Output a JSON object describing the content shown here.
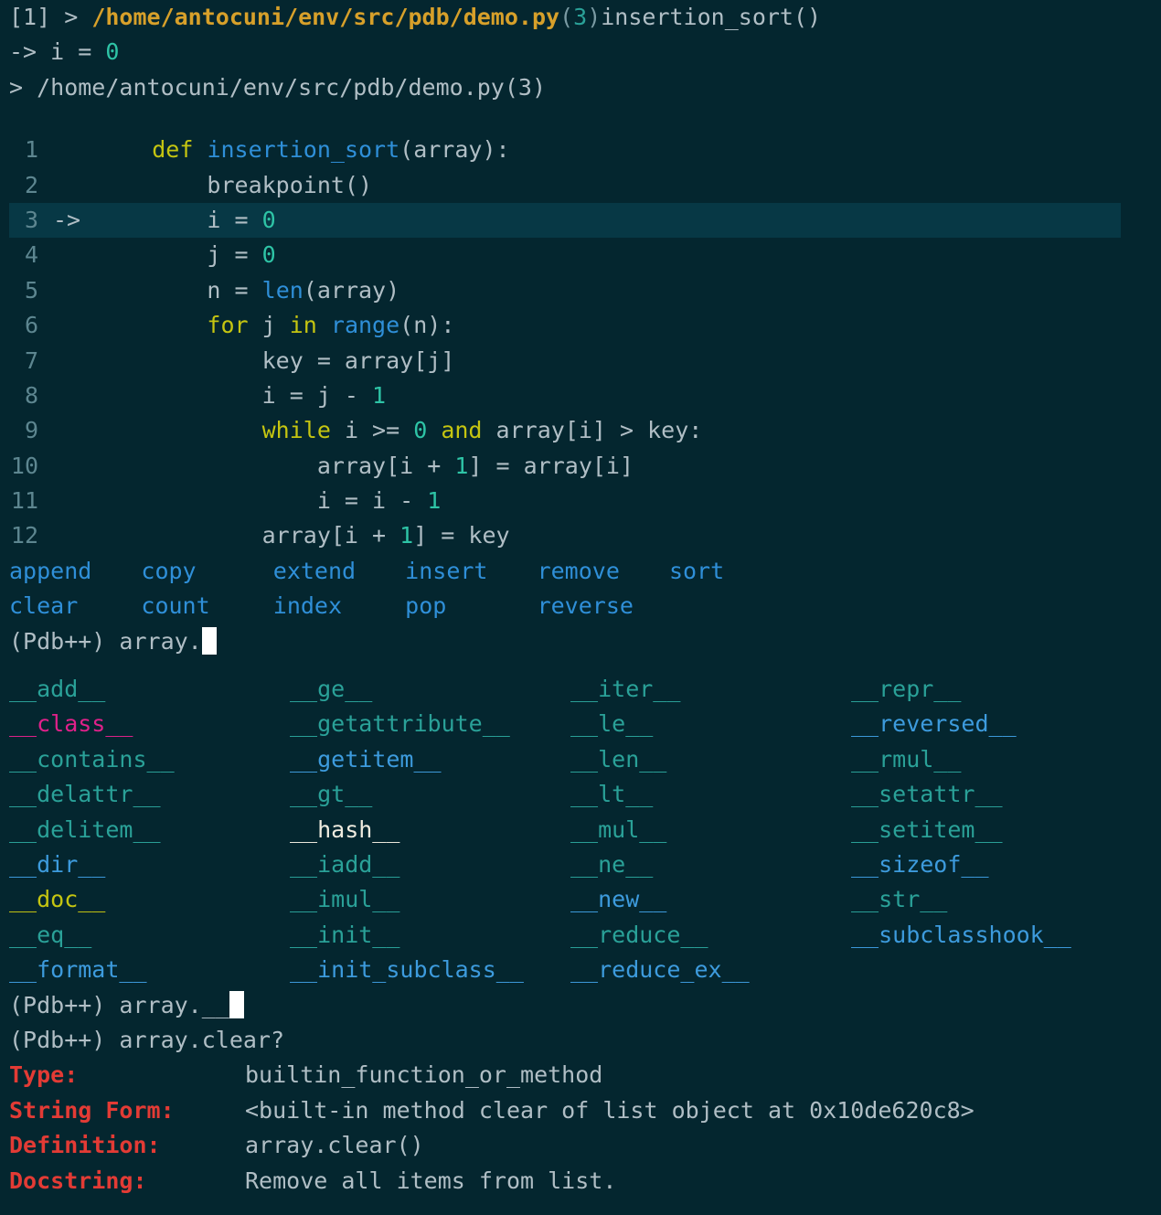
{
  "terminal": {
    "app": "pdb++ debugger session",
    "background_color": "#04262f",
    "foreground_color": "#b0bec5",
    "highlight_color": "#073845",
    "cursor_color": "#ffffff"
  },
  "header": {
    "frame_marker": "[1] > ",
    "file_path": "/home/antocuni/env/src/pdb/demo.py",
    "lineno_open": "(",
    "lineno": "3",
    "lineno_close": ")",
    "function": "insertion_sort()",
    "current_line": "-> i = 0",
    "current_line_prefix": "-> i = ",
    "current_line_value": "0",
    "location_line": "> /home/antocuni/env/src/pdb/demo.py(3)"
  },
  "listing": {
    "lines": [
      {
        "no": "1",
        "arrow": "",
        "indent": "    ",
        "current": false,
        "tokens": [
          {
            "t": "def ",
            "c": "c-yellow"
          },
          {
            "t": "insertion_sort",
            "c": "c-blue"
          },
          {
            "t": "(array):",
            "c": "c-gray"
          }
        ]
      },
      {
        "no": "2",
        "arrow": "",
        "indent": "        ",
        "current": false,
        "tokens": [
          {
            "t": "breakpoint()",
            "c": "c-gray"
          }
        ]
      },
      {
        "no": "3",
        "arrow": "->",
        "indent": "        ",
        "current": true,
        "tokens": [
          {
            "t": "i = ",
            "c": "c-gray"
          },
          {
            "t": "0",
            "c": "c-green"
          }
        ]
      },
      {
        "no": "4",
        "arrow": "",
        "indent": "        ",
        "current": false,
        "tokens": [
          {
            "t": "j = ",
            "c": "c-gray"
          },
          {
            "t": "0",
            "c": "c-green"
          }
        ]
      },
      {
        "no": "5",
        "arrow": "",
        "indent": "        ",
        "current": false,
        "tokens": [
          {
            "t": "n = ",
            "c": "c-gray"
          },
          {
            "t": "len",
            "c": "c-blue"
          },
          {
            "t": "(array)",
            "c": "c-gray"
          }
        ]
      },
      {
        "no": "6",
        "arrow": "",
        "indent": "        ",
        "current": false,
        "tokens": [
          {
            "t": "for",
            "c": "c-yellow"
          },
          {
            "t": " j ",
            "c": "c-gray"
          },
          {
            "t": "in",
            "c": "c-yellow"
          },
          {
            "t": " ",
            "c": "c-gray"
          },
          {
            "t": "range",
            "c": "c-blue"
          },
          {
            "t": "(n):",
            "c": "c-gray"
          }
        ]
      },
      {
        "no": "7",
        "arrow": "",
        "indent": "            ",
        "current": false,
        "tokens": [
          {
            "t": "key = array[j]",
            "c": "c-gray"
          }
        ]
      },
      {
        "no": "8",
        "arrow": "",
        "indent": "            ",
        "current": false,
        "tokens": [
          {
            "t": "i = j - ",
            "c": "c-gray"
          },
          {
            "t": "1",
            "c": "c-green"
          }
        ]
      },
      {
        "no": "9",
        "arrow": "",
        "indent": "            ",
        "current": false,
        "tokens": [
          {
            "t": "while",
            "c": "c-yellow"
          },
          {
            "t": " i >= ",
            "c": "c-gray"
          },
          {
            "t": "0",
            "c": "c-green"
          },
          {
            "t": " ",
            "c": "c-gray"
          },
          {
            "t": "and",
            "c": "c-yellow"
          },
          {
            "t": " array[i] > key:",
            "c": "c-gray"
          }
        ]
      },
      {
        "no": "10",
        "arrow": "",
        "indent": "                ",
        "current": false,
        "tokens": [
          {
            "t": "array[i + ",
            "c": "c-gray"
          },
          {
            "t": "1",
            "c": "c-green"
          },
          {
            "t": "] = array[i]",
            "c": "c-gray"
          }
        ]
      },
      {
        "no": "11",
        "arrow": "",
        "indent": "                ",
        "current": false,
        "tokens": [
          {
            "t": "i = i - ",
            "c": "c-gray"
          },
          {
            "t": "1",
            "c": "c-green"
          }
        ]
      },
      {
        "no": "12",
        "arrow": "",
        "indent": "            ",
        "current": false,
        "tokens": [
          {
            "t": "array[i + ",
            "c": "c-gray"
          },
          {
            "t": "1",
            "c": "c-green"
          },
          {
            "t": "] = key",
            "c": "c-gray"
          }
        ]
      }
    ]
  },
  "completion_methods": {
    "rows": [
      [
        "append",
        "copy",
        "extend",
        "insert",
        "remove",
        "sort"
      ],
      [
        "clear",
        "count",
        "index",
        "pop",
        "reverse",
        ""
      ]
    ],
    "color": "#2f8fd8"
  },
  "prompt1": {
    "prompt": "(Pdb++) ",
    "input": "array.",
    "cursor": "█"
  },
  "completion_dunders": {
    "rows": [
      [
        {
          "t": "__add__",
          "c": "c-teal"
        },
        {
          "t": "__ge__",
          "c": "c-teal"
        },
        {
          "t": "__iter__",
          "c": "c-teal"
        },
        {
          "t": "__repr__",
          "c": "c-teal"
        }
      ],
      [
        {
          "t": "__class__",
          "c": "c-pink"
        },
        {
          "t": "__getattribute__",
          "c": "c-teal"
        },
        {
          "t": "__le__",
          "c": "c-teal"
        },
        {
          "t": "__reversed__",
          "c": "c-blue2"
        }
      ],
      [
        {
          "t": "__contains__",
          "c": "c-teal"
        },
        {
          "t": "__getitem__",
          "c": "c-blue2"
        },
        {
          "t": "__len__",
          "c": "c-teal"
        },
        {
          "t": "__rmul__",
          "c": "c-teal"
        }
      ],
      [
        {
          "t": "__delattr__",
          "c": "c-teal"
        },
        {
          "t": "__gt__",
          "c": "c-teal"
        },
        {
          "t": "__lt__",
          "c": "c-teal"
        },
        {
          "t": "__setattr__",
          "c": "c-teal"
        }
      ],
      [
        {
          "t": "__delitem__",
          "c": "c-teal"
        },
        {
          "t": "__hash__",
          "c": "c-white"
        },
        {
          "t": "__mul__",
          "c": "c-teal"
        },
        {
          "t": "__setitem__",
          "c": "c-teal"
        }
      ],
      [
        {
          "t": "__dir__",
          "c": "c-blue2"
        },
        {
          "t": "__iadd__",
          "c": "c-teal"
        },
        {
          "t": "__ne__",
          "c": "c-teal"
        },
        {
          "t": "__sizeof__",
          "c": "c-blue2"
        }
      ],
      [
        {
          "t": "__doc__",
          "c": "c-yellow"
        },
        {
          "t": "__imul__",
          "c": "c-teal"
        },
        {
          "t": "__new__",
          "c": "c-blue2"
        },
        {
          "t": "__str__",
          "c": "c-teal"
        }
      ],
      [
        {
          "t": "__eq__",
          "c": "c-teal"
        },
        {
          "t": "__init__",
          "c": "c-teal"
        },
        {
          "t": "__reduce__",
          "c": "c-teal"
        },
        {
          "t": "__subclasshook__",
          "c": "c-blue2"
        }
      ],
      [
        {
          "t": "__format__",
          "c": "c-blue2"
        },
        {
          "t": "__init_subclass__",
          "c": "c-blue2"
        },
        {
          "t": "__reduce_ex__",
          "c": "c-blue2"
        },
        {
          "t": "",
          "c": "c-teal"
        }
      ]
    ]
  },
  "prompt2": {
    "prompt": "(Pdb++) ",
    "input": "array.__",
    "cursor": "█"
  },
  "prompt3": {
    "prompt": "(Pdb++) ",
    "input": "array.clear?"
  },
  "help_output": {
    "rows": [
      {
        "label": "Type:",
        "value": "builtin_function_or_method"
      },
      {
        "label": "String Form:",
        "value": "<built-in method clear of list object at 0x10de620c8>"
      },
      {
        "label": "Definition:",
        "value": "array.clear()"
      },
      {
        "label": "Docstring:",
        "value": "Remove all items from list."
      }
    ],
    "label_color": "#e33b35"
  }
}
